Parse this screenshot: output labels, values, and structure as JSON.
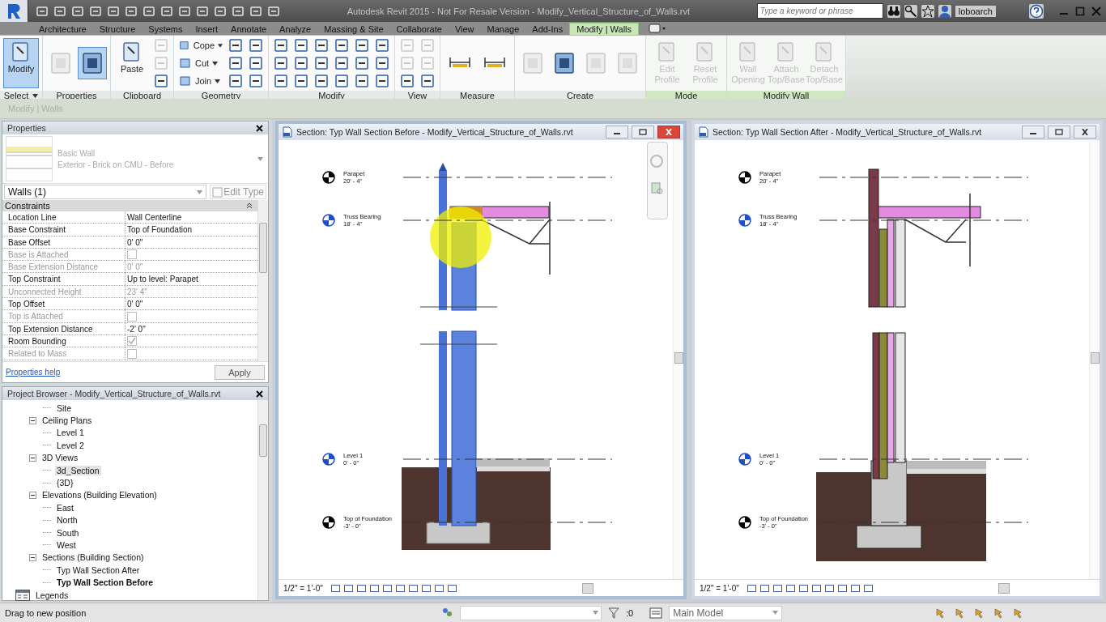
{
  "app": {
    "title": "Autodesk Revit 2015 - Not For Resale Version - Modify_Vertical_Structure_of_Walls.rvt",
    "search": {
      "placeholder": "Type a keyword or phrase"
    },
    "user": "loboarch"
  },
  "tabs": [
    {
      "label": "Architecture",
      "selected": false
    },
    {
      "label": "Structure",
      "selected": false
    },
    {
      "label": "Systems",
      "selected": false
    },
    {
      "label": "Insert",
      "selected": false
    },
    {
      "label": "Annotate",
      "selected": false
    },
    {
      "label": "Analyze",
      "selected": false
    },
    {
      "label": "Massing & Site",
      "selected": false
    },
    {
      "label": "Collaborate",
      "selected": false
    },
    {
      "label": "View",
      "selected": false
    },
    {
      "label": "Manage",
      "selected": false
    },
    {
      "label": "Add-Ins",
      "selected": false
    },
    {
      "label": "Modify | Walls",
      "selected": true
    }
  ],
  "ribbon": [
    {
      "label": "Select",
      "dropdown": true,
      "contextual": false,
      "tools": [
        {
          "kind": "large",
          "label": "Modify",
          "selected": true,
          "disabled": false
        }
      ]
    },
    {
      "label": "Properties",
      "dropdown": false,
      "contextual": false,
      "tools": [
        {
          "kind": "tall",
          "selected": false,
          "disabled": true
        },
        {
          "kind": "tall",
          "selected": true,
          "disabled": false
        }
      ]
    },
    {
      "label": "Clipboard",
      "dropdown": false,
      "contextual": false,
      "tools": [
        {
          "kind": "large",
          "label": "Paste",
          "selected": false,
          "disabled": false
        },
        {
          "kind": "icon",
          "selected": false,
          "disabled": true
        },
        {
          "kind": "icon",
          "selected": false,
          "disabled": true
        },
        {
          "kind": "icon",
          "selected": false,
          "disabled": false
        }
      ]
    },
    {
      "label": "Geometry",
      "dropdown": false,
      "contextual": false,
      "tools": [
        {
          "kind": "small",
          "label": "Cope",
          "selected": false,
          "disabled": false
        },
        {
          "kind": "small",
          "label": "Cut",
          "selected": false,
          "disabled": false
        },
        {
          "kind": "small",
          "label": "Join",
          "selected": false,
          "disabled": false
        },
        {
          "kind": "icon",
          "selected": false,
          "disabled": false
        },
        {
          "kind": "icon",
          "selected": false,
          "disabled": false
        },
        {
          "kind": "icon",
          "selected": false,
          "disabled": false
        },
        {
          "kind": "icon",
          "selected": false,
          "disabled": false
        },
        {
          "kind": "icon",
          "selected": false,
          "disabled": false
        },
        {
          "kind": "icon",
          "selected": false,
          "disabled": false
        }
      ]
    },
    {
      "label": "Modify",
      "dropdown": false,
      "contextual": false,
      "tools": [
        {
          "kind": "icon",
          "selected": false,
          "disabled": false
        },
        {
          "kind": "icon",
          "selected": false,
          "disabled": false
        },
        {
          "kind": "icon",
          "selected": false,
          "disabled": false
        },
        {
          "kind": "icon",
          "selected": false,
          "disabled": false
        },
        {
          "kind": "icon",
          "selected": false,
          "disabled": false
        },
        {
          "kind": "icon",
          "selected": false,
          "disabled": false
        },
        {
          "kind": "icon",
          "selected": false,
          "disabled": false
        },
        {
          "kind": "icon",
          "selected": false,
          "disabled": false
        },
        {
          "kind": "icon",
          "selected": false,
          "disabled": false
        },
        {
          "kind": "icon",
          "selected": false,
          "disabled": false
        },
        {
          "kind": "icon",
          "selected": false,
          "disabled": false
        },
        {
          "kind": "icon",
          "selected": false,
          "disabled": false
        },
        {
          "kind": "icon",
          "selected": false,
          "disabled": false
        },
        {
          "kind": "icon",
          "selected": false,
          "disabled": false
        },
        {
          "kind": "icon",
          "selected": false,
          "disabled": false
        },
        {
          "kind": "icon",
          "selected": false,
          "disabled": false
        },
        {
          "kind": "icon",
          "selected": false,
          "disabled": false
        },
        {
          "kind": "icon",
          "selected": false,
          "disabled": false
        }
      ]
    },
    {
      "label": "View",
      "dropdown": false,
      "contextual": false,
      "tools": [
        {
          "kind": "icon",
          "selected": false,
          "disabled": true
        },
        {
          "kind": "icon",
          "selected": false,
          "disabled": true
        },
        {
          "kind": "icon",
          "selected": false,
          "disabled": false
        },
        {
          "kind": "icon",
          "selected": false,
          "disabled": true
        },
        {
          "kind": "icon",
          "selected": false,
          "disabled": true
        },
        {
          "kind": "icon",
          "selected": false,
          "disabled": false
        }
      ]
    },
    {
      "label": "Measure",
      "dropdown": false,
      "contextual": false,
      "tools": [
        {
          "kind": "wide",
          "selected": false,
          "disabled": false
        },
        {
          "kind": "wide",
          "selected": false,
          "disabled": false
        }
      ]
    },
    {
      "label": "Create",
      "dropdown": false,
      "contextual": false,
      "tools": [
        {
          "kind": "tall",
          "selected": false,
          "disabled": true
        },
        {
          "kind": "tall",
          "selected": false,
          "disabled": false
        },
        {
          "kind": "tall",
          "selected": false,
          "disabled": true
        },
        {
          "kind": "tall",
          "selected": false,
          "disabled": true
        }
      ]
    },
    {
      "label": "Mode",
      "dropdown": false,
      "contextual": true,
      "tools": [
        {
          "kind": "large",
          "label": "Edit Profile",
          "selected": false,
          "disabled": true
        },
        {
          "kind": "large",
          "label": "Reset Profile",
          "selected": false,
          "disabled": true
        }
      ]
    },
    {
      "label": "Modify Wall",
      "dropdown": false,
      "contextual": true,
      "tools": [
        {
          "kind": "large",
          "label": "Wall Opening",
          "selected": false,
          "disabled": true
        },
        {
          "kind": "large",
          "label": "Attach Top/Base",
          "selected": false,
          "disabled": true
        },
        {
          "kind": "large",
          "label": "Detach Top/Base",
          "selected": false,
          "disabled": true
        }
      ]
    }
  ],
  "options_bar": {
    "label": "Modify | Walls"
  },
  "properties": {
    "title": "Properties",
    "type_family": "Basic Wall",
    "type_name": "Exterior - Brick on CMU - Before",
    "selector": "Walls (1)",
    "edit_type": "Edit Type",
    "group": "Constraints",
    "rows": [
      {
        "name": "Location Line",
        "kind": "text",
        "value": "Wall Centerline",
        "disabled": false
      },
      {
        "name": "Base Constraint",
        "kind": "text",
        "value": "Top of Foundation",
        "disabled": false
      },
      {
        "name": "Base Offset",
        "kind": "text",
        "value": "0' 0\"",
        "disabled": false
      },
      {
        "name": "Base is Attached",
        "kind": "checkbox",
        "checked": false,
        "disabled": true
      },
      {
        "name": "Base Extension Distance",
        "kind": "text",
        "value": "0' 0\"",
        "disabled": true
      },
      {
        "name": "Top Constraint",
        "kind": "text",
        "value": "Up to level: Parapet",
        "disabled": false
      },
      {
        "name": "Unconnected Height",
        "kind": "text",
        "value": "23' 4\"",
        "disabled": true
      },
      {
        "name": "Top Offset",
        "kind": "text",
        "value": "0' 0\"",
        "disabled": false
      },
      {
        "name": "Top is Attached",
        "kind": "checkbox",
        "checked": false,
        "disabled": true
      },
      {
        "name": "Top Extension Distance",
        "kind": "text",
        "value": "-2' 0\"",
        "disabled": false
      },
      {
        "name": "Room Bounding",
        "kind": "checkbox",
        "checked": true,
        "disabled": false
      },
      {
        "name": "Related to Mass",
        "kind": "checkbox",
        "checked": false,
        "disabled": true
      }
    ],
    "help": "Properties help",
    "apply": "Apply"
  },
  "browser": {
    "title": "Project Browser - Modify_Vertical_Structure_of_Walls.rvt",
    "tree": [
      {
        "children": [
          {
            "children": [
              {
                "label": "Site",
                "selected": false,
                "current": false
              }
            ]
          },
          {
            "label": "Ceiling Plans",
            "expanded": true,
            "selected": false,
            "current": false,
            "children": [
              {
                "label": "Level 1",
                "selected": false,
                "current": false
              },
              {
                "label": "Level 2",
                "selected": false,
                "current": false
              }
            ]
          },
          {
            "label": "3D Views",
            "expanded": true,
            "selected": false,
            "current": false,
            "children": [
              {
                "label": "3d_Section",
                "selected": true,
                "current": false
              },
              {
                "label": "{3D}",
                "selected": false,
                "current": false
              }
            ]
          },
          {
            "label": "Elevations (Building Elevation)",
            "expanded": true,
            "selected": false,
            "current": false,
            "children": [
              {
                "label": "East",
                "selected": false,
                "current": false
              },
              {
                "label": "North",
                "selected": false,
                "current": false
              },
              {
                "label": "South",
                "selected": false,
                "current": false
              },
              {
                "label": "West",
                "selected": false,
                "current": false
              }
            ]
          },
          {
            "label": "Sections (Building Section)",
            "expanded": true,
            "selected": false,
            "current": false,
            "children": [
              {
                "label": "Typ Wall Section After",
                "selected": false,
                "current": false
              },
              {
                "label": "Typ Wall Section Before",
                "selected": false,
                "current": true
              }
            ]
          }
        ]
      },
      {
        "label": "Legends",
        "kind": "legends",
        "selected": false,
        "current": false
      }
    ]
  },
  "views": [
    {
      "title": "Section: Typ Wall Section Before - Modify_Vertical_Structure_of_Walls.rvt",
      "active": true,
      "wall_selected": true,
      "scale": "1/2\" = 1'-0\"",
      "levels": [
        {
          "name": "Parapet",
          "elevation": "20' - 4\"",
          "color": "#000000"
        },
        {
          "name": "Truss Bearing",
          "elevation": "18' - 4\"",
          "color": "#1f4fc8"
        },
        {
          "name": "Level 1",
          "elevation": "0' - 0\"",
          "color": "#1f4fc8"
        },
        {
          "name": "Top of Foundation",
          "elevation": "-3' - 0\"",
          "color": "#000000"
        }
      ]
    },
    {
      "title": "Section: Typ Wall Section After - Modify_Vertical_Structure_of_Walls.rvt",
      "active": false,
      "wall_selected": false,
      "scale": "1/2\" = 1'-0\"",
      "levels": [
        {
          "name": "Parapet",
          "elevation": "20' - 4\"",
          "color": "#000000"
        },
        {
          "name": "Truss Bearing",
          "elevation": "18' - 4\"",
          "color": "#1f4fc8"
        },
        {
          "name": "Level 1",
          "elevation": "0' - 0\"",
          "color": "#1f4fc8"
        },
        {
          "name": "Top of Foundation",
          "elevation": "-3' - 0\"",
          "color": "#000000"
        }
      ]
    }
  ],
  "status_bar": {
    "message": "Drag to new position",
    "filter_count": ":0",
    "model": "Main Model"
  }
}
